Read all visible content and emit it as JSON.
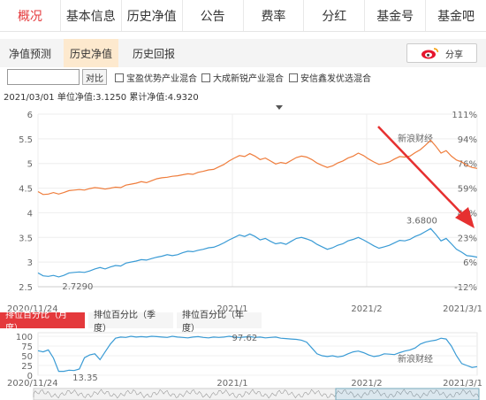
{
  "tabs": [
    {
      "label": "概况",
      "active": true
    },
    {
      "label": "基本信息",
      "active": false
    },
    {
      "label": "历史净值",
      "active": false
    },
    {
      "label": "公告",
      "active": false
    },
    {
      "label": "费率",
      "active": false
    },
    {
      "label": "分红",
      "active": false
    },
    {
      "label": "基金号",
      "active": false
    },
    {
      "label": "基金吧",
      "active": false
    }
  ],
  "subtabs": [
    {
      "label": "净值预测",
      "active": false
    },
    {
      "label": "历史净值",
      "active": true
    },
    {
      "label": "历史回报",
      "active": false
    }
  ],
  "share_label": "分享",
  "compare": {
    "input_value": "",
    "button_label": "对比",
    "options": [
      "宝盈优势产业混合",
      "大成新锐产业混合",
      "安信鑫发优选混合"
    ]
  },
  "info_line": "2021/03/01 单位净值:3.1250 累计净值:4.9320",
  "watermark": "新浪财经",
  "colors": {
    "accent": "#e4393c",
    "cumulative": "#ef7d3c",
    "unit": "#3a9bd5",
    "rank": "#3a9bd5",
    "arrow": "#e63030"
  },
  "chart_data": [
    {
      "type": "line",
      "title": "",
      "x_tick_labels": [
        "2020/11/24",
        "2021/1",
        "2021/2",
        "2021/3/1"
      ],
      "y_left_ticks": [
        "6",
        "5.5",
        "5",
        "4.5",
        "4",
        "3.5",
        "3",
        "2.5"
      ],
      "y_right_ticks": [
        "111%",
        "94%",
        "76%",
        "59%",
        "41%",
        "23%",
        "6%",
        "-12%"
      ],
      "ylim": [
        2.5,
        6
      ],
      "series": [
        {
          "role": "cumulative",
          "values": [
            4.43,
            4.37,
            4.38,
            4.41,
            4.38,
            4.41,
            4.45,
            4.46,
            4.47,
            4.46,
            4.49,
            4.51,
            4.5,
            4.48,
            4.5,
            4.52,
            4.51,
            4.56,
            4.58,
            4.6,
            4.63,
            4.61,
            4.65,
            4.69,
            4.71,
            4.72,
            4.74,
            4.75,
            4.77,
            4.79,
            4.78,
            4.82,
            4.84,
            4.87,
            4.88,
            4.93,
            4.98,
            5.05,
            5.11,
            5.16,
            5.14,
            5.2,
            5.15,
            5.08,
            5.11,
            5.05,
            4.99,
            5.02,
            5.0,
            5.06,
            5.12,
            5.15,
            5.13,
            5.08,
            5.01,
            4.96,
            4.92,
            4.95,
            5.01,
            5.05,
            5.11,
            5.15,
            5.21,
            5.16,
            5.09,
            5.03,
            4.98,
            5.0,
            5.03,
            5.09,
            5.14,
            5.13,
            5.15,
            5.22,
            5.28,
            5.37,
            5.47,
            5.35,
            5.21,
            5.26,
            5.15,
            5.07,
            5.03,
            4.96,
            4.92,
            4.9
          ]
        },
        {
          "role": "unit",
          "values": [
            2.78,
            2.72,
            2.71,
            2.73,
            2.7,
            2.73,
            2.78,
            2.79,
            2.8,
            2.79,
            2.82,
            2.86,
            2.89,
            2.86,
            2.9,
            2.93,
            2.92,
            2.98,
            3.0,
            3.02,
            3.05,
            3.04,
            3.07,
            3.1,
            3.12,
            3.15,
            3.13,
            3.15,
            3.19,
            3.22,
            3.21,
            3.24,
            3.26,
            3.29,
            3.3,
            3.34,
            3.39,
            3.45,
            3.5,
            3.55,
            3.52,
            3.57,
            3.52,
            3.45,
            3.48,
            3.42,
            3.37,
            3.39,
            3.36,
            3.42,
            3.48,
            3.5,
            3.47,
            3.43,
            3.36,
            3.31,
            3.26,
            3.29,
            3.34,
            3.37,
            3.43,
            3.46,
            3.5,
            3.45,
            3.39,
            3.33,
            3.28,
            3.31,
            3.34,
            3.39,
            3.44,
            3.43,
            3.46,
            3.52,
            3.56,
            3.62,
            3.68,
            3.56,
            3.43,
            3.48,
            3.37,
            3.26,
            3.2,
            3.13,
            3.12,
            3.1
          ]
        }
      ],
      "annotations": [
        {
          "label": "3.6800",
          "index": 76,
          "value": 3.68
        },
        {
          "label": "2.7290",
          "index": 4,
          "value": 2.7
        }
      ]
    },
    {
      "type": "line",
      "role": "rank",
      "x_tick_labels": [
        "2020/11/24",
        "2021/1",
        "2021/2",
        "2021/3/1"
      ],
      "y_ticks": [
        "100",
        "75",
        "50",
        "25",
        "0"
      ],
      "ylim": [
        0,
        100
      ],
      "values": [
        63,
        60,
        65,
        44,
        10,
        10,
        13,
        12,
        16,
        45,
        52,
        55,
        40,
        60,
        80,
        95,
        98,
        97,
        100,
        98,
        99,
        98,
        100,
        99,
        98,
        97,
        100,
        98,
        97,
        96,
        98,
        99,
        97,
        96,
        98,
        97,
        98,
        100,
        98,
        97,
        98,
        99,
        97,
        98,
        96,
        97,
        98,
        95,
        94,
        93,
        92,
        90,
        85,
        70,
        55,
        50,
        48,
        50,
        47,
        49,
        55,
        60,
        62,
        58,
        52,
        48,
        50,
        55,
        54,
        53,
        58,
        62,
        65,
        70,
        80,
        85,
        88,
        90,
        95,
        93,
        75,
        50,
        30,
        25,
        20,
        22
      ],
      "annotations": [
        {
          "label": "97.62",
          "index": 40,
          "value": 97.62
        },
        {
          "label": "13.35",
          "index": 6,
          "value": 13.35
        }
      ]
    }
  ],
  "rank_tabs": [
    {
      "label": "排位百分比（月度）",
      "active": true
    },
    {
      "label": "排位百分比（季度）",
      "active": false
    },
    {
      "label": "排位百分比（年度）",
      "active": false
    }
  ]
}
